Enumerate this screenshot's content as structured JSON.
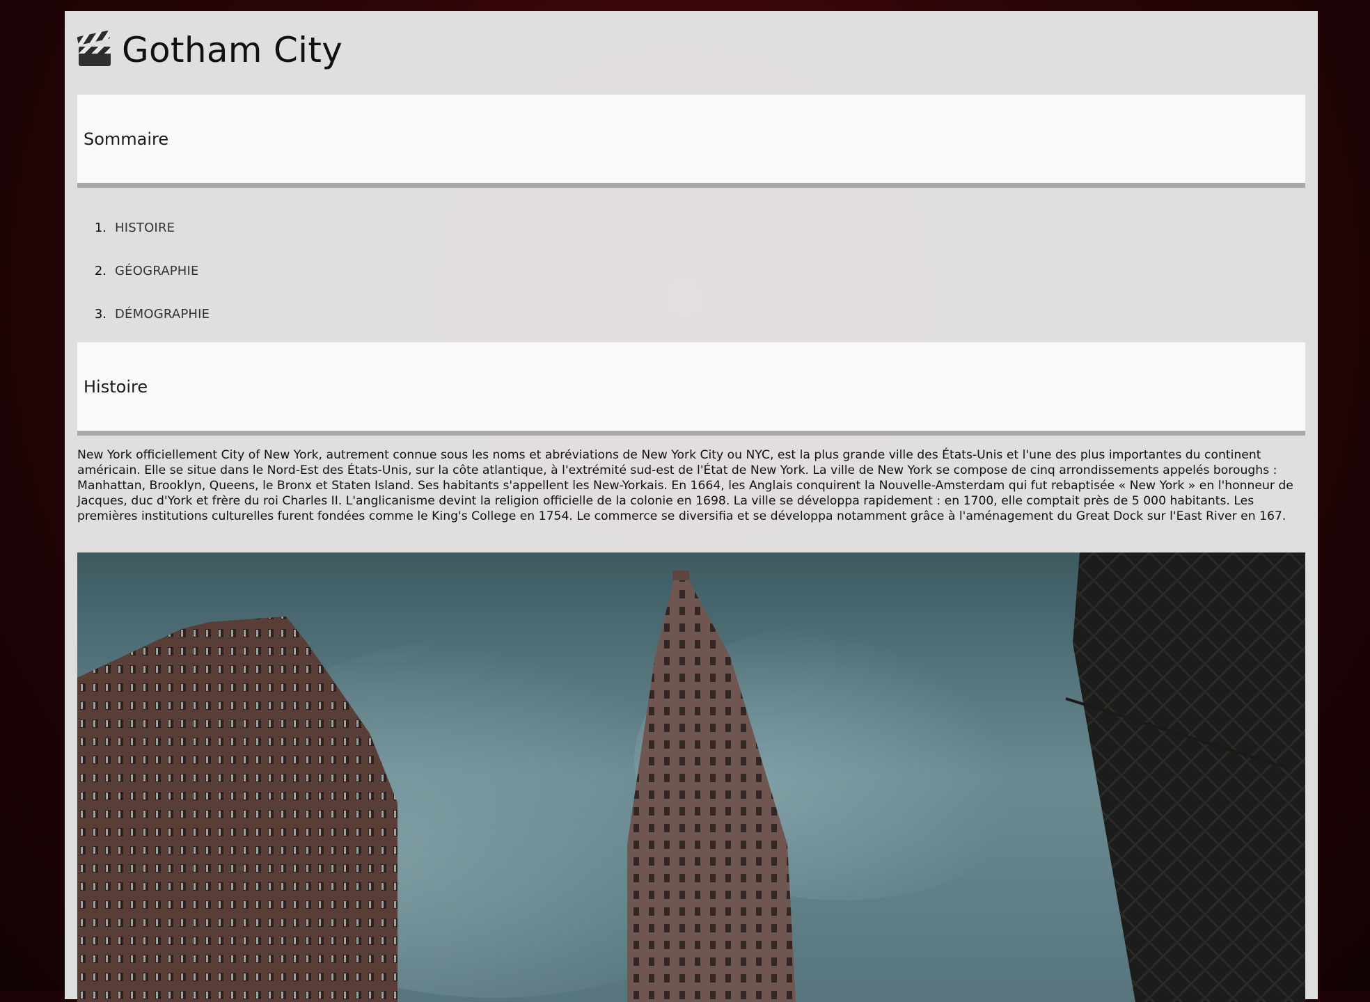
{
  "header": {
    "title": "Gotham City",
    "icon": "clapperboard-icon"
  },
  "toc": {
    "heading": "Sommaire",
    "items": [
      {
        "num": "1.",
        "label": "HISTOIRE"
      },
      {
        "num": "2.",
        "label": "GÉOGRAPHIE"
      },
      {
        "num": "3.",
        "label": "DÉMOGRAPHIE"
      }
    ]
  },
  "history": {
    "heading": "Histoire",
    "text": "New York officiellement City of New York, autrement connue sous les noms et abréviations de New York City ou NYC, est la plus grande ville des États-Unis et l'une des plus importantes du continent américain. Elle se situe dans le Nord-Est des États-Unis, sur la côte atlantique, à l'extrémité sud-est de l'État de New York. La ville de New York se compose de cinq arrondissements appelés boroughs : Manhattan, Brooklyn, Queens, le Bronx et Staten Island. Ses habitants s'appellent les New-Yorkais. En 1664, les Anglais conquirent la Nouvelle-Amsterdam qui fut rebaptisée « New York » en l'honneur de Jacques, duc d'York et frère du roi Charles II. L'anglicanisme devint la religion officielle de la colonie en 1698. La ville se développa rapidement : en 1700, elle comptait près de 5 000 habitants. Les premières institutions culturelles furent fondées comme le King's College en 1754. Le commerce se diversifia et se développa notamment grâce à l'aménagement du Great Dock sur l'East River en 167."
  },
  "colors": {
    "background": "#2a0508",
    "panel": "#ececec",
    "header_bar": "#f9f9f9",
    "rule": "#a9a9a9"
  }
}
